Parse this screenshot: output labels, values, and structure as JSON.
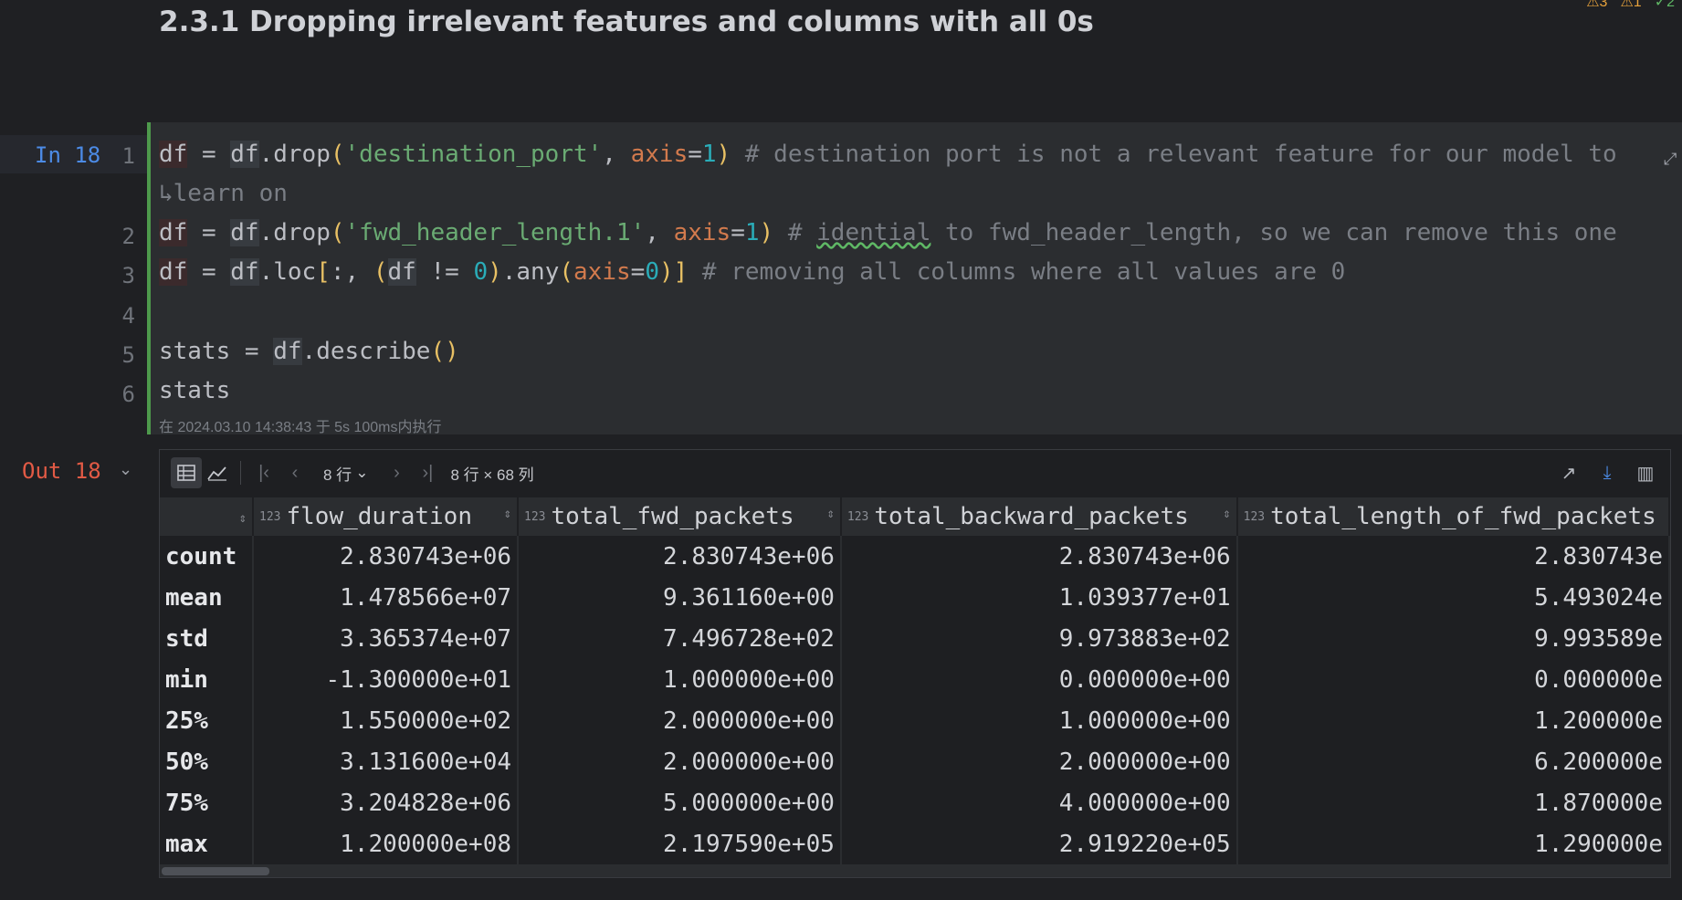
{
  "heading": "2.3.1 Dropping irrelevant features and columns with all 0s",
  "inspections": {
    "warnings": "3",
    "weak": "1",
    "checks": "2"
  },
  "cell": {
    "in_label": "In 18",
    "line_numbers": [
      "1",
      "2",
      "3",
      "4",
      "5",
      "6"
    ],
    "exec_info": "在 2024.03.10 14:38:43 于 5s 100ms内执行"
  },
  "code": {
    "l1_var": "df",
    "l1_eq": " = ",
    "l1_obj": "df",
    "l1_method": ".drop",
    "l1_open": "(",
    "l1_str": "'destination_port'",
    "l1_comma": ", ",
    "l1_kw": "axis",
    "l1_eqs": "=",
    "l1_num": "1",
    "l1_close": ")",
    "l1_comment": " # destination port is not a relevant feature for our model to ",
    "l1_wrap": "learn on",
    "l2_var": "df",
    "l2_eq": " = ",
    "l2_obj": "df",
    "l2_method": ".drop",
    "l2_open": "(",
    "l2_str": "'fwd_header_length.1'",
    "l2_comma": ", ",
    "l2_kw": "axis",
    "l2_eqs": "=",
    "l2_num": "1",
    "l2_close": ")",
    "l2_cmt_a": " # ",
    "l2_typo": "idential",
    "l2_cmt_b": " to fwd_header_length, so we can remove this one",
    "l3_var": "df",
    "l3_eq": " = ",
    "l3_obj": "df",
    "l3_method": ".loc",
    "l3_bo": "[",
    "l3_slice": ":, ",
    "l3_po": "(",
    "l3_df": "df",
    "l3_ne": " != ",
    "l3_zero": "0",
    "l3_pc": ")",
    "l3_any": ".any",
    "l3_ao": "(",
    "l3_kw": "axis",
    "l3_eqs": "=",
    "l3_num": "0",
    "l3_ac": ")",
    "l3_bc": "]",
    "l3_comment": " # removing all columns where all values are 0",
    "l5_a": "stats = ",
    "l5_obj": "df",
    "l5_method": ".describe",
    "l5_paren": "()",
    "l6": "stats"
  },
  "output": {
    "out_label": "Out 18",
    "toolbar": {
      "rows_select": "8 行",
      "shape": "8 行 × 68 列"
    },
    "table": {
      "columns": [
        "flow_duration",
        "total_fwd_packets",
        "total_backward_packets",
        "total_length_of_fwd_packets"
      ],
      "type_icon": "123",
      "rows": [
        {
          "index": "count",
          "values": [
            "2.830743e+06",
            "2.830743e+06",
            "2.830743e+06",
            "2.830743e"
          ]
        },
        {
          "index": "mean",
          "values": [
            "1.478566e+07",
            "9.361160e+00",
            "1.039377e+01",
            "5.493024e"
          ]
        },
        {
          "index": "std",
          "values": [
            "3.365374e+07",
            "7.496728e+02",
            "9.973883e+02",
            "9.993589e"
          ]
        },
        {
          "index": "min",
          "values": [
            "-1.300000e+01",
            "1.000000e+00",
            "0.000000e+00",
            "0.000000e"
          ]
        },
        {
          "index": "25%",
          "values": [
            "1.550000e+02",
            "2.000000e+00",
            "1.000000e+00",
            "1.200000e"
          ]
        },
        {
          "index": "50%",
          "values": [
            "3.131600e+04",
            "2.000000e+00",
            "2.000000e+00",
            "6.200000e"
          ]
        },
        {
          "index": "75%",
          "values": [
            "3.204828e+06",
            "5.000000e+00",
            "4.000000e+00",
            "1.870000e"
          ]
        },
        {
          "index": "max",
          "values": [
            "1.200000e+08",
            "2.197590e+05",
            "2.919220e+05",
            "1.290000e"
          ]
        }
      ]
    }
  }
}
